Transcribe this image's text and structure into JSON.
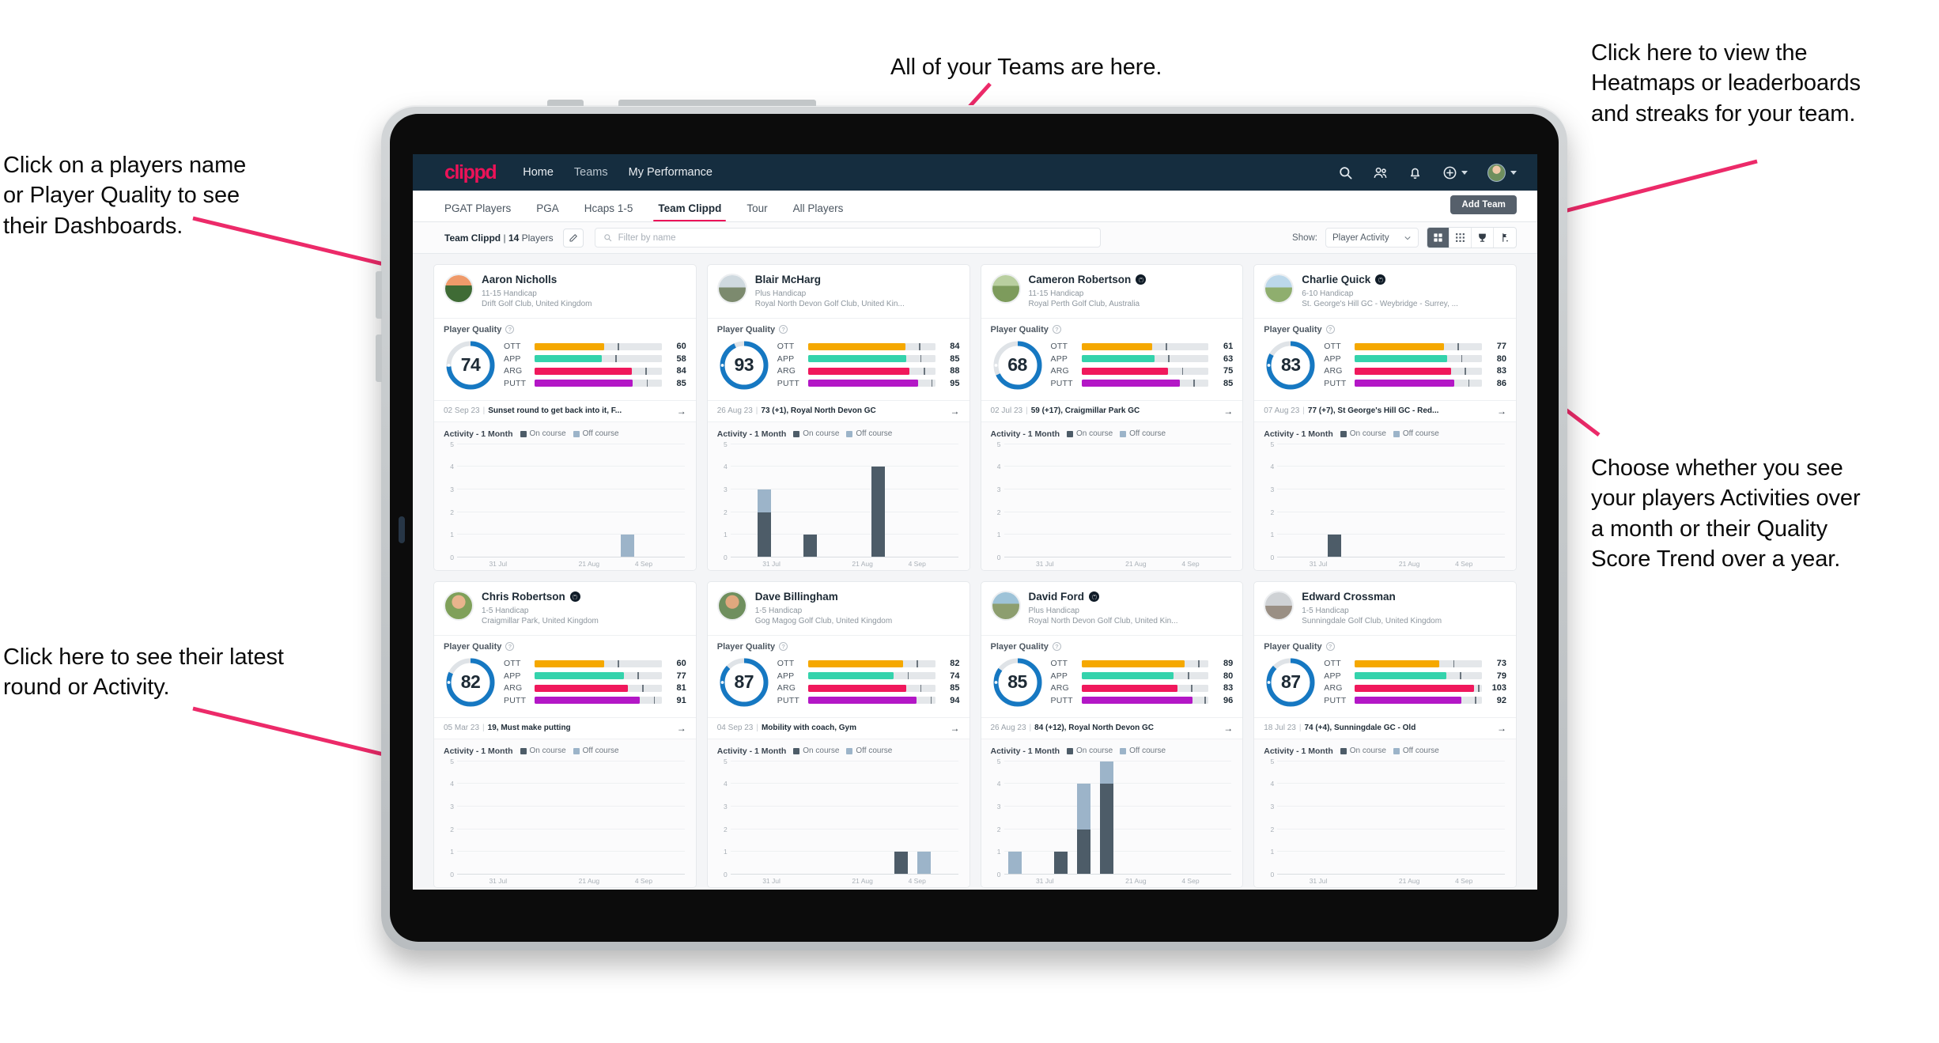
{
  "colors": {
    "brand_pink": "#ec1258",
    "nav_dark": "#152d3f",
    "donut_blue": "#1678c2",
    "ott": "#f5a800",
    "app": "#34d3ac",
    "arg": "#f0185c",
    "putt": "#b317c6",
    "on_course": "#4d5c68",
    "off_course": "#9cb4c9"
  },
  "annotations": [
    {
      "id": "teams-note",
      "text": "All of your Teams are here."
    },
    {
      "id": "heatmaps-note",
      "text": "Click here to view the\nHeatmaps or leaderboards\nand streaks for your team."
    },
    {
      "id": "players-note",
      "text": "Click on a players name\nor Player Quality to see\ntheir Dashboards."
    },
    {
      "id": "activity-note",
      "text": "Choose whether you see\nyour players Activities over\na month or their Quality\nScore Trend over a year."
    },
    {
      "id": "latest-round-note",
      "text": "Click here to see their latest\nround or Activity."
    }
  ],
  "topnav": {
    "logo": "clippd",
    "links": [
      {
        "label": "Home",
        "active": true
      },
      {
        "label": "Teams",
        "active": false
      },
      {
        "label": "My Performance",
        "active": false
      }
    ],
    "icons": [
      "search-icon",
      "people-icon",
      "bell-icon",
      "plus-circle-icon",
      "avatar"
    ]
  },
  "tabbar": {
    "tabs": [
      {
        "label": "PGAT Players",
        "active": false
      },
      {
        "label": "PGA",
        "active": false
      },
      {
        "label": "Hcaps 1-5",
        "active": false
      },
      {
        "label": "Team Clippd",
        "active": true
      },
      {
        "label": "Tour",
        "active": false
      },
      {
        "label": "All Players",
        "active": false
      }
    ],
    "add_team_label": "Add Team"
  },
  "filterbar": {
    "team_name": "Team Clippd",
    "player_count": "14",
    "players_word": "Players",
    "separator": "|",
    "edit_icon": "pencil-icon",
    "search_placeholder": "Filter by name",
    "show_label": "Show:",
    "show_value": "Player Activity",
    "views": [
      {
        "name": "grid-view-icon",
        "active": true
      },
      {
        "name": "dense-grid-view-icon",
        "active": false
      },
      {
        "name": "trophy-view-icon",
        "active": false
      },
      {
        "name": "flag-leaderboard-icon",
        "active": false
      }
    ]
  },
  "card_labels": {
    "quality_title": "Player Quality",
    "activity_title": "Activity - 1 Month",
    "legend_on": "On course",
    "legend_off": "Off course",
    "metric_labels": [
      "OTT",
      "APP",
      "ARG",
      "PUTT"
    ],
    "y_ticks": [
      "5",
      "4",
      "3",
      "2",
      "1",
      "0"
    ],
    "x_ticks": [
      "31 Jul",
      "21 Aug",
      "4 Sep"
    ],
    "arrow": "→"
  },
  "players": [
    {
      "name": "Aaron Nicholls",
      "verified": false,
      "handicap": "11-15 Handicap",
      "club": "Drift Golf Club, United Kingdom",
      "quality_score": 74,
      "metrics": [
        {
          "label": "OTT",
          "value": 60
        },
        {
          "label": "APP",
          "value": 58
        },
        {
          "label": "ARG",
          "value": 84
        },
        {
          "label": "PUTT",
          "value": 85
        }
      ],
      "last_date": "02 Sep 23",
      "last_text": "Sunset round to get back into it, F...",
      "chart_data": {
        "type": "bar",
        "ylim": [
          0,
          5
        ],
        "categories": [
          "31 Jul",
          "21 Aug",
          "4 Sep"
        ],
        "bins": 10,
        "on_course": [
          0,
          0,
          0,
          0,
          0,
          0,
          0,
          0,
          0,
          0
        ],
        "off_course": [
          0,
          0,
          0,
          0,
          0,
          0,
          0,
          1,
          0,
          0
        ]
      }
    },
    {
      "name": "Blair McHarg",
      "verified": false,
      "handicap": "Plus Handicap",
      "club": "Royal North Devon Golf Club, United Kin...",
      "quality_score": 93,
      "metrics": [
        {
          "label": "OTT",
          "value": 84
        },
        {
          "label": "APP",
          "value": 85
        },
        {
          "label": "ARG",
          "value": 88
        },
        {
          "label": "PUTT",
          "value": 95
        }
      ],
      "last_date": "26 Aug 23",
      "last_text": "73 (+1), Royal North Devon GC",
      "chart_data": {
        "type": "bar",
        "ylim": [
          0,
          5
        ],
        "categories": [
          "31 Jul",
          "21 Aug",
          "4 Sep"
        ],
        "bins": 10,
        "on_course": [
          0,
          2,
          0,
          1,
          0,
          0,
          4,
          0,
          0,
          0
        ],
        "off_course": [
          0,
          1,
          0,
          0,
          0,
          0,
          0,
          0,
          0,
          0
        ]
      }
    },
    {
      "name": "Cameron Robertson",
      "verified": true,
      "handicap": "11-15 Handicap",
      "club": "Royal Perth Golf Club, Australia",
      "quality_score": 68,
      "metrics": [
        {
          "label": "OTT",
          "value": 61
        },
        {
          "label": "APP",
          "value": 63
        },
        {
          "label": "ARG",
          "value": 75
        },
        {
          "label": "PUTT",
          "value": 85
        }
      ],
      "last_date": "02 Jul 23",
      "last_text": "59 (+17), Craigmillar Park GC",
      "chart_data": {
        "type": "bar",
        "ylim": [
          0,
          5
        ],
        "categories": [
          "31 Jul",
          "21 Aug",
          "4 Sep"
        ],
        "bins": 10,
        "on_course": [
          0,
          0,
          0,
          0,
          0,
          0,
          0,
          0,
          0,
          0
        ],
        "off_course": [
          0,
          0,
          0,
          0,
          0,
          0,
          0,
          0,
          0,
          0
        ]
      }
    },
    {
      "name": "Charlie Quick",
      "verified": true,
      "handicap": "6-10 Handicap",
      "club": "St. George's Hill GC - Weybridge - Surrey, ...",
      "quality_score": 83,
      "metrics": [
        {
          "label": "OTT",
          "value": 77
        },
        {
          "label": "APP",
          "value": 80
        },
        {
          "label": "ARG",
          "value": 83
        },
        {
          "label": "PUTT",
          "value": 86
        }
      ],
      "last_date": "07 Aug 23",
      "last_text": "77 (+7), St George's Hill GC - Red...",
      "chart_data": {
        "type": "bar",
        "ylim": [
          0,
          5
        ],
        "categories": [
          "31 Jul",
          "21 Aug",
          "4 Sep"
        ],
        "bins": 10,
        "on_course": [
          0,
          0,
          1,
          0,
          0,
          0,
          0,
          0,
          0,
          0
        ],
        "off_course": [
          0,
          0,
          0,
          0,
          0,
          0,
          0,
          0,
          0,
          0
        ]
      }
    },
    {
      "name": "Chris Robertson",
      "verified": true,
      "handicap": "1-5 Handicap",
      "club": "Craigmillar Park, United Kingdom",
      "quality_score": 82,
      "metrics": [
        {
          "label": "OTT",
          "value": 60
        },
        {
          "label": "APP",
          "value": 77
        },
        {
          "label": "ARG",
          "value": 81
        },
        {
          "label": "PUTT",
          "value": 91
        }
      ],
      "last_date": "05 Mar 23",
      "last_text": "19, Must make putting",
      "chart_data": {
        "type": "bar",
        "ylim": [
          0,
          5
        ],
        "categories": [
          "31 Jul",
          "21 Aug",
          "4 Sep"
        ],
        "bins": 10,
        "on_course": [
          0,
          0,
          0,
          0,
          0,
          0,
          0,
          0,
          0,
          0
        ],
        "off_course": [
          0,
          0,
          0,
          0,
          0,
          0,
          0,
          0,
          0,
          0
        ]
      }
    },
    {
      "name": "Dave Billingham",
      "verified": false,
      "handicap": "1-5 Handicap",
      "club": "Gog Magog Golf Club, United Kingdom",
      "quality_score": 87,
      "metrics": [
        {
          "label": "OTT",
          "value": 82
        },
        {
          "label": "APP",
          "value": 74
        },
        {
          "label": "ARG",
          "value": 85
        },
        {
          "label": "PUTT",
          "value": 94
        }
      ],
      "last_date": "04 Sep 23",
      "last_text": "Mobility with coach, Gym",
      "chart_data": {
        "type": "bar",
        "ylim": [
          0,
          5
        ],
        "categories": [
          "31 Jul",
          "21 Aug",
          "4 Sep"
        ],
        "bins": 10,
        "on_course": [
          0,
          0,
          0,
          0,
          0,
          0,
          0,
          1,
          0,
          0
        ],
        "off_course": [
          0,
          0,
          0,
          0,
          0,
          0,
          0,
          0,
          1,
          0
        ]
      }
    },
    {
      "name": "David Ford",
      "verified": true,
      "handicap": "Plus Handicap",
      "club": "Royal North Devon Golf Club, United Kin...",
      "quality_score": 85,
      "metrics": [
        {
          "label": "OTT",
          "value": 89
        },
        {
          "label": "APP",
          "value": 80
        },
        {
          "label": "ARG",
          "value": 83
        },
        {
          "label": "PUTT",
          "value": 96
        }
      ],
      "last_date": "26 Aug 23",
      "last_text": "84 (+12), Royal North Devon GC",
      "chart_data": {
        "type": "bar",
        "ylim": [
          0,
          5
        ],
        "categories": [
          "31 Jul",
          "21 Aug",
          "4 Sep"
        ],
        "bins": 10,
        "on_course": [
          0,
          0,
          1,
          2,
          4,
          0,
          0,
          0,
          0,
          0
        ],
        "off_course": [
          1,
          0,
          0,
          2,
          1,
          0,
          0,
          0,
          0,
          0
        ]
      }
    },
    {
      "name": "Edward Crossman",
      "verified": false,
      "handicap": "1-5 Handicap",
      "club": "Sunningdale Golf Club, United Kingdom",
      "quality_score": 87,
      "metrics": [
        {
          "label": "OTT",
          "value": 73
        },
        {
          "label": "APP",
          "value": 79
        },
        {
          "label": "ARG",
          "value": 103
        },
        {
          "label": "PUTT",
          "value": 92
        }
      ],
      "last_date": "18 Jul 23",
      "last_text": "74 (+4), Sunningdale GC - Old",
      "chart_data": {
        "type": "bar",
        "ylim": [
          0,
          5
        ],
        "categories": [
          "31 Jul",
          "21 Aug",
          "4 Sep"
        ],
        "bins": 10,
        "on_course": [
          0,
          0,
          0,
          0,
          0,
          0,
          0,
          0,
          0,
          0
        ],
        "off_course": [
          0,
          0,
          0,
          0,
          0,
          0,
          0,
          0,
          0,
          0
        ]
      }
    }
  ]
}
